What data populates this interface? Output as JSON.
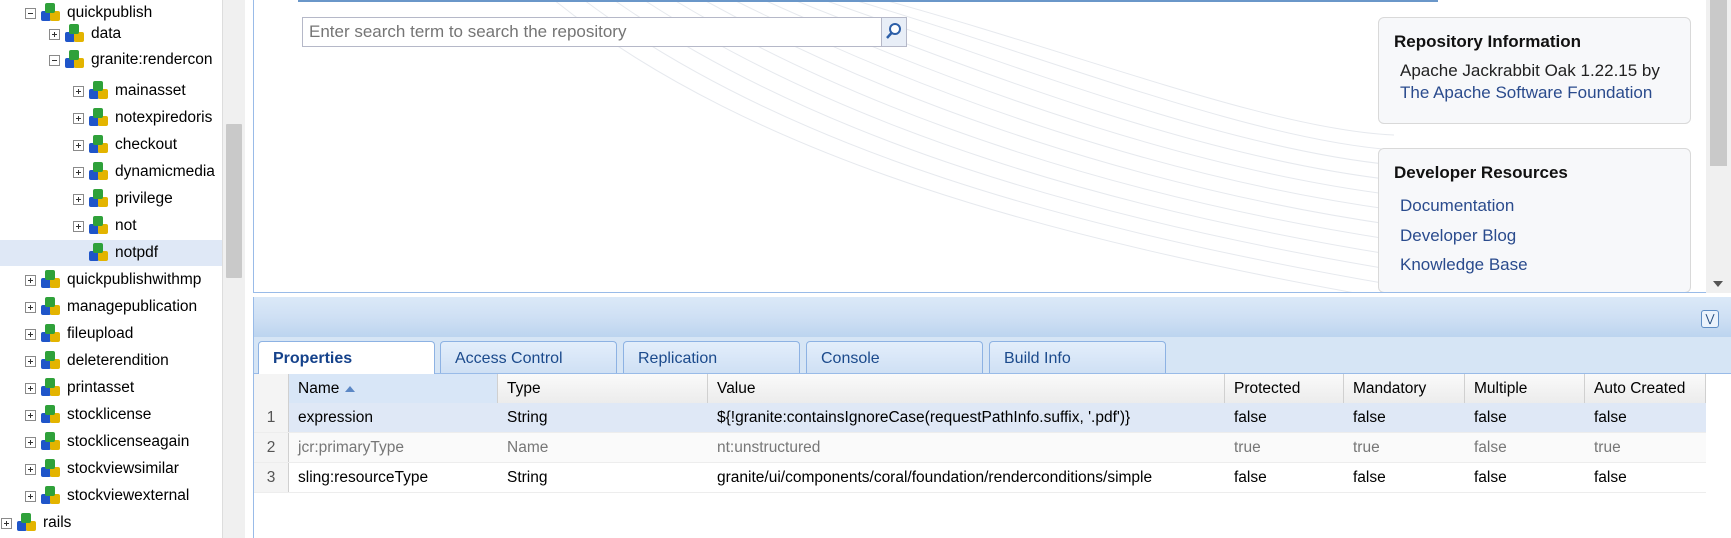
{
  "tree": {
    "nodes": [
      {
        "label": "quickpublish",
        "toggle": "minus"
      },
      {
        "label": "data",
        "toggle": "plus"
      },
      {
        "label": "granite:rendercon",
        "toggle": "minus"
      },
      {
        "label": "mainasset",
        "toggle": "plus"
      },
      {
        "label": "notexpiredoris",
        "toggle": "plus"
      },
      {
        "label": "checkout",
        "toggle": "plus"
      },
      {
        "label": "dynamicmedia",
        "toggle": "plus"
      },
      {
        "label": "privilege",
        "toggle": "plus"
      },
      {
        "label": "not",
        "toggle": "plus"
      },
      {
        "label": "notpdf",
        "toggle": "none",
        "selected": true
      },
      {
        "label": "quickpublishwithmp",
        "toggle": "plus"
      },
      {
        "label": "managepublication",
        "toggle": "plus"
      },
      {
        "label": "fileupload",
        "toggle": "plus"
      },
      {
        "label": "deleterendition",
        "toggle": "plus"
      },
      {
        "label": "printasset",
        "toggle": "plus"
      },
      {
        "label": "stocklicense",
        "toggle": "plus"
      },
      {
        "label": "stocklicenseagain",
        "toggle": "plus"
      },
      {
        "label": "stockviewsimilar",
        "toggle": "plus"
      },
      {
        "label": "stockviewexternal",
        "toggle": "plus"
      },
      {
        "label": "rails",
        "toggle": "plus"
      }
    ]
  },
  "search": {
    "placeholder": "Enter search term to search the repository"
  },
  "repo_info": {
    "title": "Repository Information",
    "text": "Apache Jackrabbit Oak 1.22.15 by",
    "link": "The Apache Software Foundation"
  },
  "dev_resources": {
    "title": "Developer Resources",
    "links": [
      "Documentation",
      "Developer Blog",
      "Knowledge Base"
    ]
  },
  "tabs": [
    "Properties",
    "Access Control",
    "Replication",
    "Console",
    "Build Info"
  ],
  "grid": {
    "columns": [
      "Name",
      "Type",
      "Value",
      "Protected",
      "Mandatory",
      "Multiple",
      "Auto Created"
    ],
    "rows": [
      {
        "num": "1",
        "cells": [
          "expression",
          "String",
          "${!granite:containsIgnoreCase(requestPathInfo.suffix, '.pdf')}",
          "false",
          "false",
          "false",
          "false"
        ]
      },
      {
        "num": "2",
        "cells": [
          "jcr:primaryType",
          "Name",
          "nt:unstructured",
          "true",
          "true",
          "false",
          "true"
        ]
      },
      {
        "num": "3",
        "cells": [
          "sling:resourceType",
          "String",
          "granite/ui/components/coral/foundation/renderconditions/simple",
          "false",
          "false",
          "false",
          "false"
        ]
      }
    ]
  }
}
